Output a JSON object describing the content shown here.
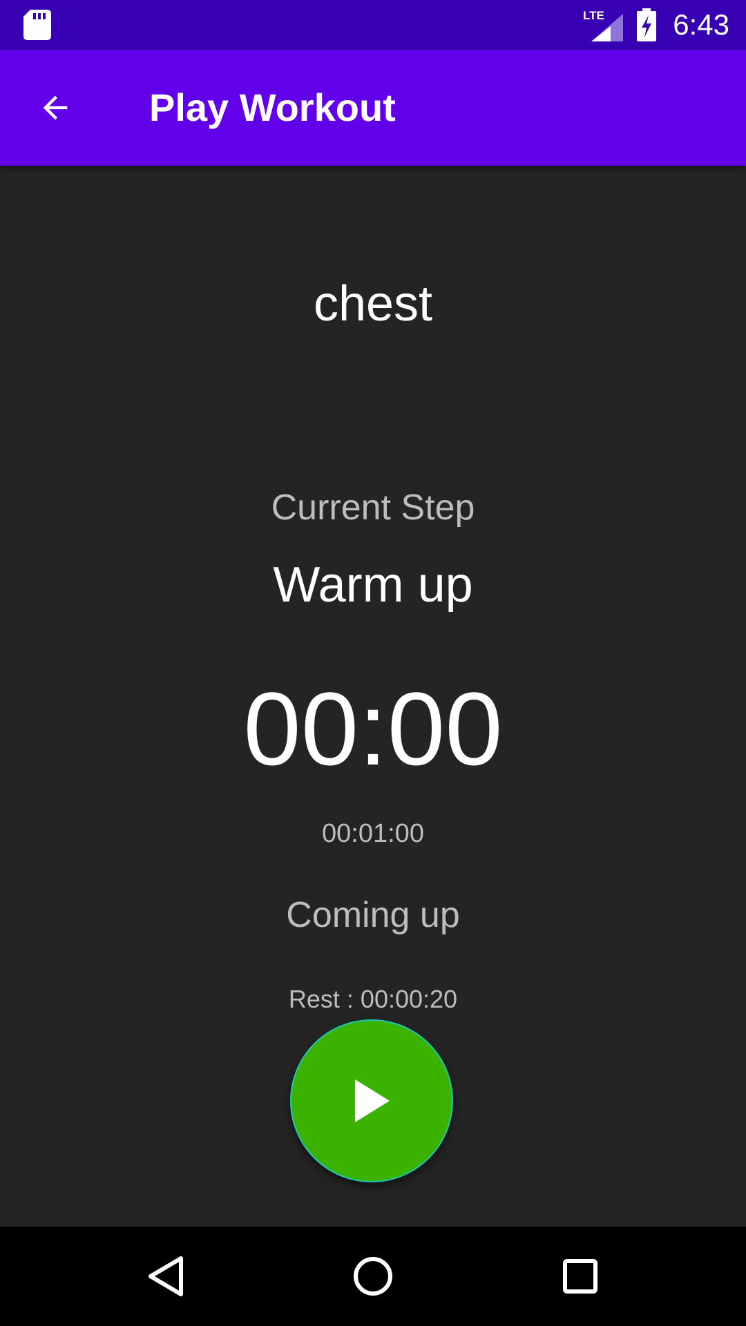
{
  "status_bar": {
    "time": "6:43",
    "network_label": "LTE",
    "icons": [
      "sd-card-icon",
      "lte-signal-icon",
      "battery-charging-icon"
    ]
  },
  "app_bar": {
    "title": "Play Workout",
    "back_icon": "arrow-back-icon"
  },
  "workout": {
    "name": "chest",
    "current_step_label": "Current Step",
    "current_step_name": "Warm up",
    "timer": "00:00",
    "step_duration": "00:01:00",
    "coming_up_label": "Coming up",
    "next_step": "Rest : 00:00:20"
  },
  "play_button": {
    "icon": "play-icon"
  },
  "nav_bar": {
    "icons": [
      "nav-back-icon",
      "nav-home-icon",
      "nav-recents-icon"
    ]
  },
  "colors": {
    "status_bar": "#3700b3",
    "app_bar": "#6200ea",
    "background": "#242424",
    "play_button": "#3cb200",
    "play_button_border": "#1ec8b8",
    "primary_text": "#ffffff",
    "secondary_text": "#bdbdbd"
  }
}
